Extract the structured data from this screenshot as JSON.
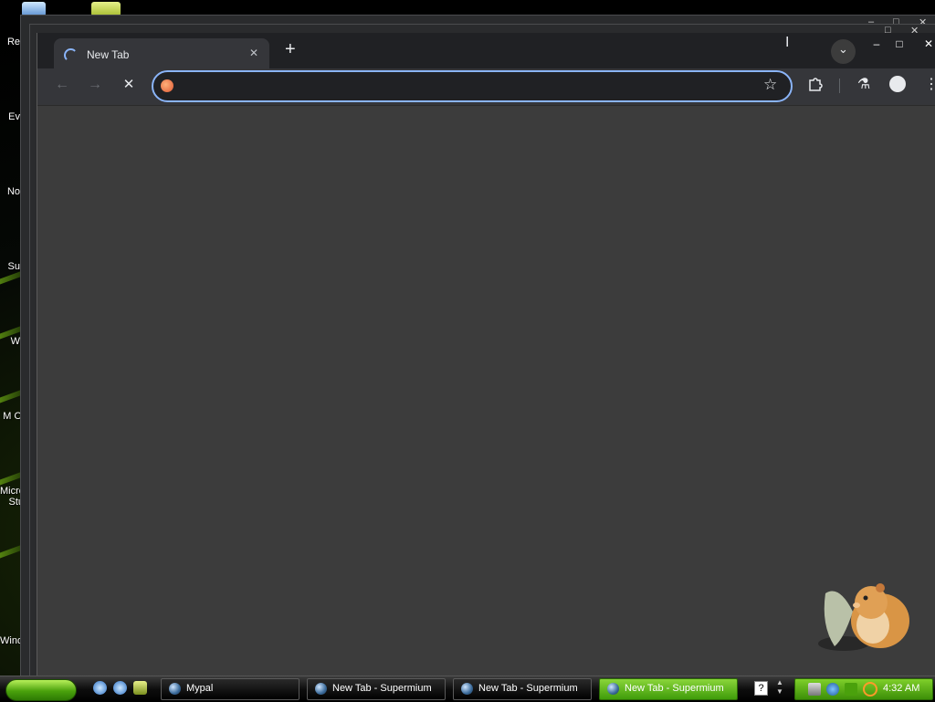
{
  "desktop": {
    "icons": [
      "Re",
      "Ev",
      "No",
      "Su",
      "W",
      "M O",
      "Micro Stu",
      "Wind"
    ]
  },
  "browser": {
    "tab_title": "New Tab",
    "omnibox_value": "",
    "icons": {
      "back": "←",
      "forward": "→",
      "stop": "✕",
      "close_tab": "✕",
      "new_tab": "+",
      "star": "☆",
      "extensions": "puzzle",
      "labs": "⚗",
      "menu": "⋮",
      "tab_search": "⌄"
    },
    "window_controls": {
      "minimize": "–",
      "maximize": "□",
      "close": "✕"
    }
  },
  "taskbar": {
    "items": [
      {
        "label": "Mypal",
        "active": false
      },
      {
        "label": "New Tab - Supermium",
        "active": false
      },
      {
        "label": "New Tab - Supermium",
        "active": false
      },
      {
        "label": "New Tab - Supermium",
        "active": true
      }
    ],
    "help_icon": "?",
    "clock": "4:32 AM"
  },
  "colors": {
    "accent": "#8ab4f8",
    "taskbar_green": "#4aa10c",
    "window_bg": "#3c3c3c"
  }
}
